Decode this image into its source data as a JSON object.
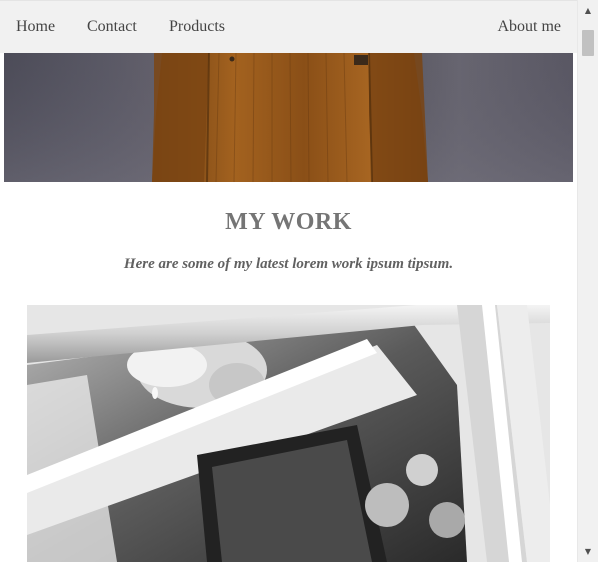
{
  "navbar": {
    "items": [
      {
        "label": "Home"
      },
      {
        "label": "Contact"
      },
      {
        "label": "Products"
      }
    ],
    "right_item": {
      "label": "About me"
    },
    "background": "#f1f1f1"
  },
  "hero": {
    "image_subject": "person in brown corduroy jacket, back view"
  },
  "section": {
    "title": "MY WORK",
    "subtitle": "Here are some of my latest lorem work ipsum tipsum."
  },
  "work_image": {
    "image_subject": "black and white photo of a bride in a vintage car"
  },
  "scrollbar": {
    "up_icon": "triangle-up-icon",
    "down_icon": "triangle-down-icon"
  },
  "colors": {
    "text": "#757575",
    "nav_text": "#444444",
    "page_bg": "#ffffff"
  }
}
